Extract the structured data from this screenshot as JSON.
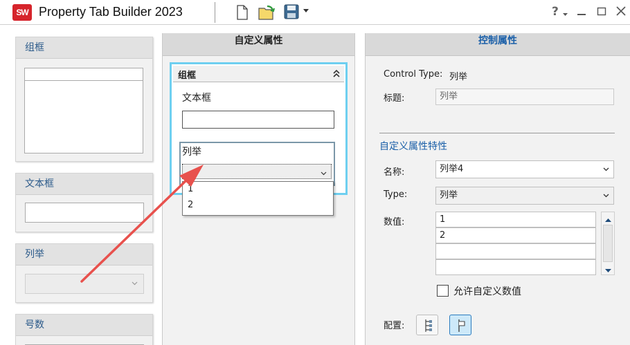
{
  "window": {
    "logo_text": "SW",
    "title": "Property Tab Builder 2023",
    "help_symbol": "?",
    "icons": [
      "new-file-icon",
      "open-file-icon",
      "save-icon",
      "dropdown-arrow-icon",
      "help-icon",
      "minimize-icon",
      "maximize-icon",
      "close-icon"
    ]
  },
  "palette": {
    "items": [
      {
        "label": "组框"
      },
      {
        "label": "文本框"
      },
      {
        "label": "列举"
      },
      {
        "label": "号数"
      }
    ]
  },
  "middle": {
    "header": "自定义属性",
    "group": {
      "title": "组框",
      "textbox_label": "文本框",
      "list_label": "列举",
      "dropdown_options": [
        "1",
        "2"
      ]
    }
  },
  "right": {
    "header": "控制属性",
    "control_type_label": "Control Type:",
    "control_type_value": "列举",
    "title_label": "标题:",
    "title_value": "列举",
    "section_title": "自定义属性特性",
    "name_label": "名称:",
    "name_value": "列举4",
    "type_label": "Type:",
    "type_value": "列举",
    "values_label": "数值:",
    "values": [
      "1",
      "2",
      "",
      ""
    ],
    "allow_custom_label": "允许自定义数值",
    "allow_custom_checked": false,
    "config_label": "配置:"
  },
  "colors": {
    "accent_blue": "#1a5fa8",
    "selection_border": "#6ecff0",
    "annotation_arrow": "#e8514d",
    "logo_red": "#d6242b"
  }
}
